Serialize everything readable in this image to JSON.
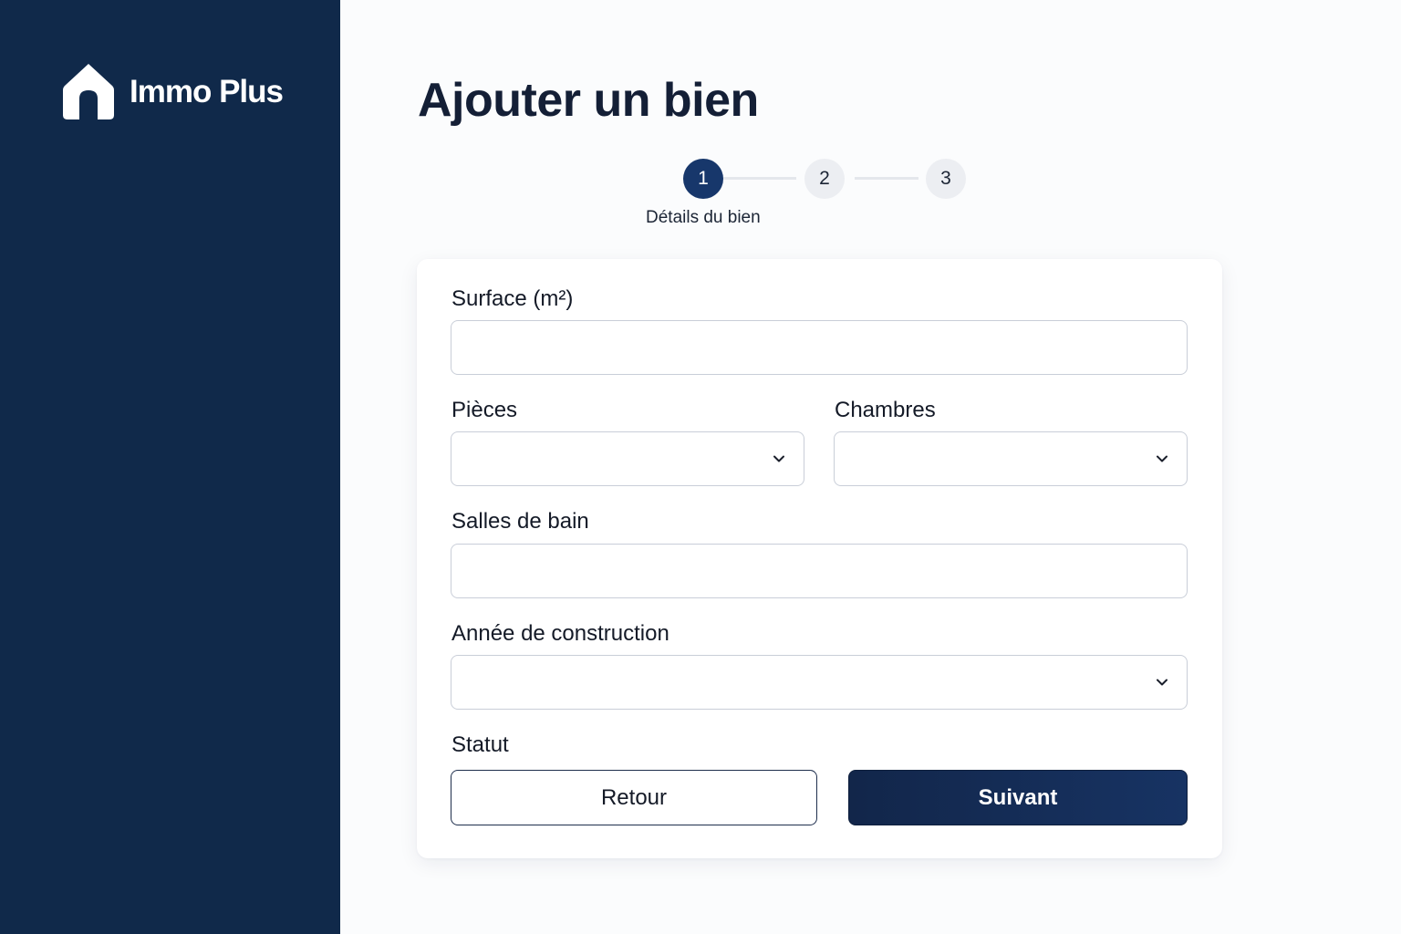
{
  "brand": {
    "name": "Immo Plus",
    "icon": "house-icon"
  },
  "page": {
    "title": "Ajouter un bien"
  },
  "stepper": {
    "steps": [
      "1",
      "2",
      "3"
    ],
    "active_step": 1,
    "active_caption": "Détails du bien"
  },
  "form": {
    "surface_label": "Surface (m²)",
    "surface_value": "",
    "rooms_label": "Pièces",
    "rooms_value": "",
    "bedrooms_label": "Chambres",
    "bedrooms_value": "",
    "bathrooms_label": "Salles de bain",
    "bathrooms_value": "",
    "year_label": "Année de construction",
    "year_value": "",
    "status_label": "Statut"
  },
  "actions": {
    "back_label": "Retour",
    "next_label": "Suivant"
  },
  "colors": {
    "sidebar": "#10294a",
    "accent": "#17376b",
    "primary_button": "#12264a",
    "background": "#fbfcfd"
  }
}
